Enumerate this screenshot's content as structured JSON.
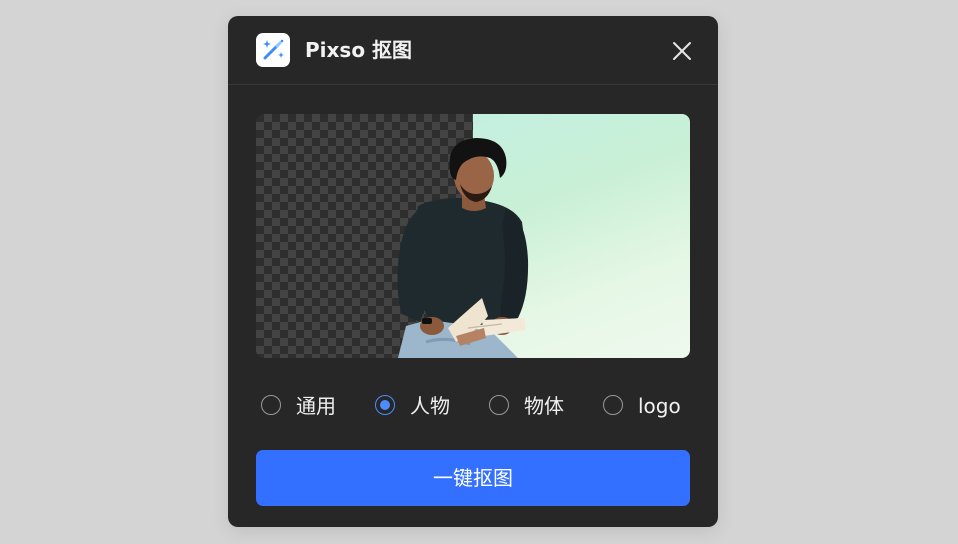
{
  "dialog": {
    "title": "Pixso 抠图",
    "app_icon": "magic-wand-icon",
    "close_icon": "close-icon"
  },
  "preview": {
    "left_background": "transparent-checkerboard",
    "right_background": "mint-gradient"
  },
  "options": [
    {
      "label": "通用",
      "checked": false
    },
    {
      "label": "人物",
      "checked": true
    },
    {
      "label": "物体",
      "checked": false
    },
    {
      "label": "logo",
      "checked": false
    }
  ],
  "action": {
    "label": "一键抠图"
  },
  "colors": {
    "dialog_bg": "#272727",
    "accent": "#3370ff",
    "radio_selected": "#4d8cff",
    "page_bg": "#d4d4d4"
  }
}
